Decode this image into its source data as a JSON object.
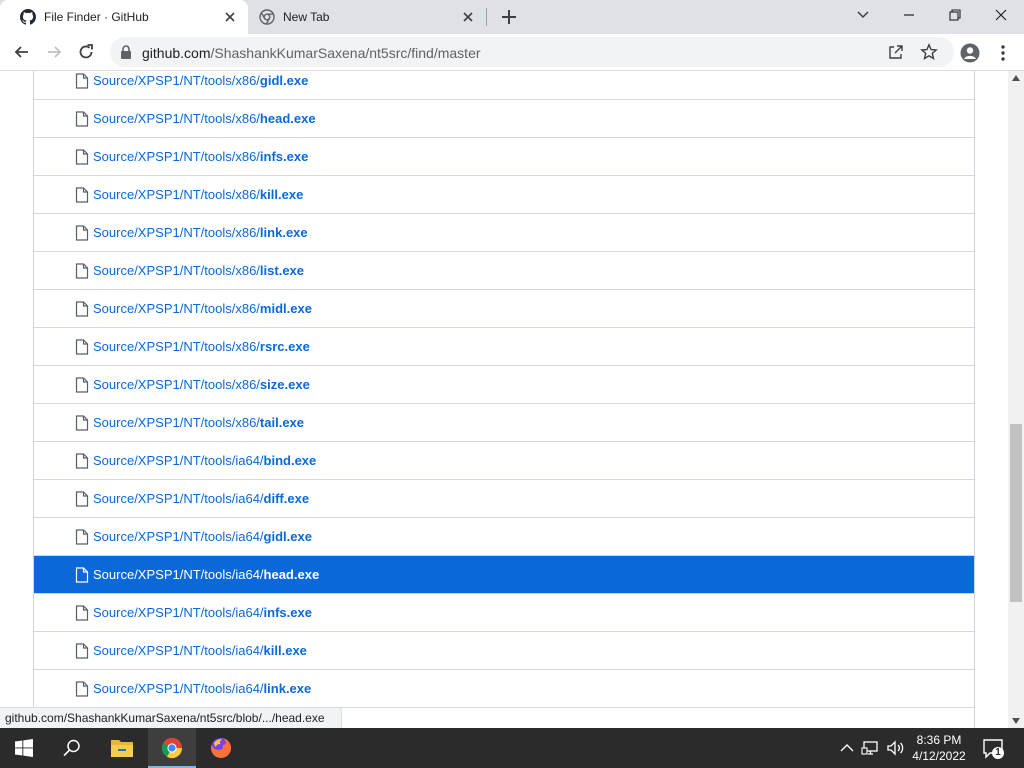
{
  "browser": {
    "tabs": [
      {
        "title": "File Finder · GitHub",
        "icon": "github-icon"
      },
      {
        "title": "New Tab",
        "icon": "chrome-icon"
      }
    ],
    "address": {
      "host": "github.com",
      "path": "/ShashankKumarSaxena/nt5src/find/master"
    }
  },
  "files": [
    {
      "dir": "Source/XPSP1/NT/tools/x86/",
      "name": "gidl",
      "ext": ".exe"
    },
    {
      "dir": "Source/XPSP1/NT/tools/x86/",
      "name": "head",
      "ext": ".exe"
    },
    {
      "dir": "Source/XPSP1/NT/tools/x86/",
      "name": "infs",
      "ext": ".exe"
    },
    {
      "dir": "Source/XPSP1/NT/tools/x86/",
      "name": "kill",
      "ext": ".exe"
    },
    {
      "dir": "Source/XPSP1/NT/tools/x86/",
      "name": "link",
      "ext": ".exe"
    },
    {
      "dir": "Source/XPSP1/NT/tools/x86/",
      "name": "list",
      "ext": ".exe"
    },
    {
      "dir": "Source/XPSP1/NT/tools/x86/",
      "name": "midl",
      "ext": ".exe"
    },
    {
      "dir": "Source/XPSP1/NT/tools/x86/",
      "name": "rsrc",
      "ext": ".exe"
    },
    {
      "dir": "Source/XPSP1/NT/tools/x86/",
      "name": "size",
      "ext": ".exe"
    },
    {
      "dir": "Source/XPSP1/NT/tools/x86/",
      "name": "tail",
      "ext": ".exe"
    },
    {
      "dir": "Source/XPSP1/NT/tools/ia64/",
      "name": "bind",
      "ext": ".exe"
    },
    {
      "dir": "Source/XPSP1/NT/tools/ia64/",
      "name": "diff",
      "ext": ".exe"
    },
    {
      "dir": "Source/XPSP1/NT/tools/ia64/",
      "name": "gidl",
      "ext": ".exe"
    },
    {
      "dir": "Source/XPSP1/NT/tools/ia64/",
      "name": "head",
      "ext": ".exe",
      "selected": true
    },
    {
      "dir": "Source/XPSP1/NT/tools/ia64/",
      "name": "infs",
      "ext": ".exe"
    },
    {
      "dir": "Source/XPSP1/NT/tools/ia64/",
      "name": "kill",
      "ext": ".exe"
    },
    {
      "dir": "Source/XPSP1/NT/tools/ia64/",
      "name": "link",
      "ext": ".exe"
    },
    {
      "dir": "",
      "name": "",
      "ext": ""
    }
  ],
  "status_bar": {
    "link": "github.com/ShashankKumarSaxena/nt5src/blob/.../head.exe"
  },
  "taskbar": {
    "apps": [
      "start-icon",
      "search-icon",
      "file-explorer-icon",
      "chrome-icon",
      "firefox-icon"
    ],
    "active_app": "chrome-icon",
    "time": "8:36 PM",
    "date": "4/12/2022",
    "notifications": "1"
  },
  "colors": {
    "link": "#0969da",
    "selected_row": "#0a68d8",
    "taskbar": "#2b2b2b"
  }
}
